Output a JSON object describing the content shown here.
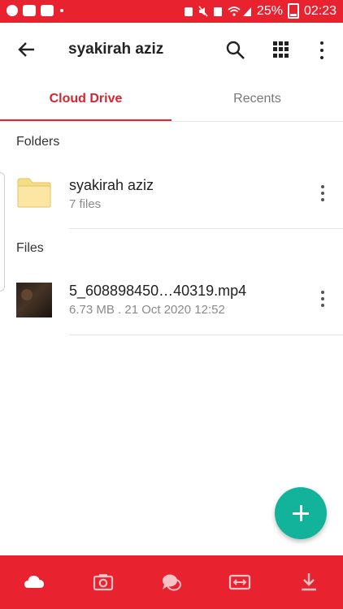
{
  "statusbar": {
    "battery": "25%",
    "time": "02:23"
  },
  "appbar": {
    "title": "syakirah aziz"
  },
  "tabs": [
    {
      "label": "Cloud Drive",
      "active": true
    },
    {
      "label": "Recents",
      "active": false
    }
  ],
  "sections": {
    "folders": "Folders",
    "files": "Files"
  },
  "folder": {
    "name": "syakirah aziz",
    "meta": "7 files"
  },
  "file": {
    "name": "5_608898450…40319.mp4",
    "meta": "6.73 MB . 21 Oct 2020 12:52"
  },
  "colors": {
    "accent": "#e8232f",
    "fab": "#13b39b"
  },
  "bottom_nav_icons": [
    "cloud-drive-icon",
    "camera-uploads-icon",
    "chat-icon",
    "transfers-icon",
    "offline-download-icon"
  ]
}
